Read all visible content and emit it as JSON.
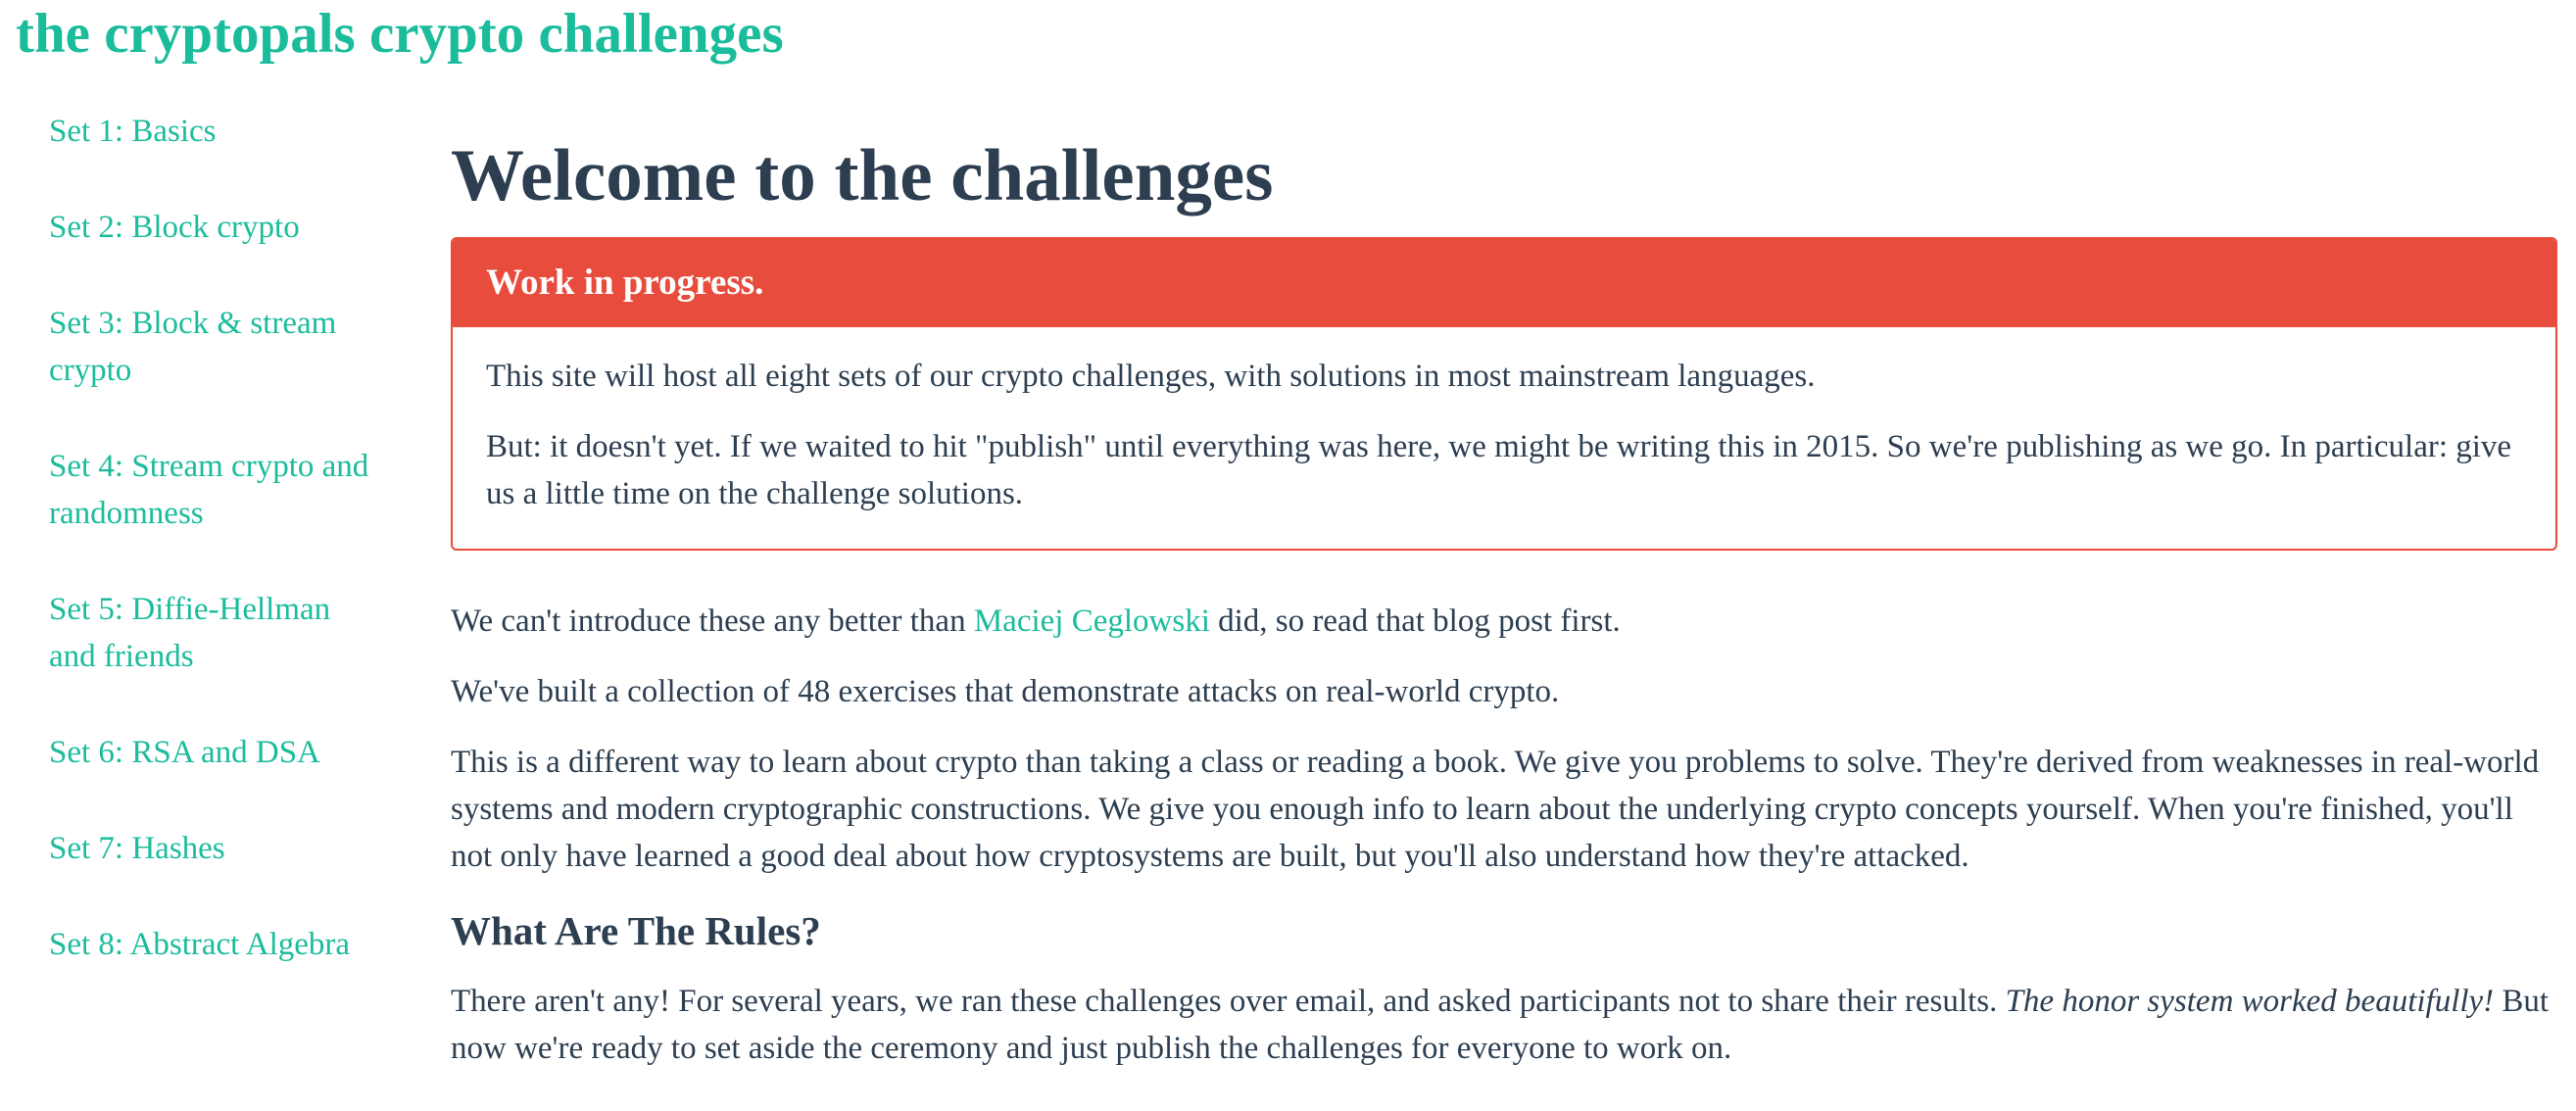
{
  "site": {
    "title": "the cryptopals crypto challenges"
  },
  "sidebar": {
    "items": [
      {
        "label": "Set 1: Basics"
      },
      {
        "label": "Set 2: Block crypto"
      },
      {
        "label": "Set 3: Block & stream crypto"
      },
      {
        "label": "Set 4: Stream crypto and randomness"
      },
      {
        "label": "Set 5: Diffie-Hellman and friends"
      },
      {
        "label": "Set 6: RSA and DSA"
      },
      {
        "label": "Set 7: Hashes"
      },
      {
        "label": "Set 8: Abstract Algebra"
      }
    ]
  },
  "main": {
    "title": "Welcome to the challenges",
    "alert": {
      "heading": "Work in progress.",
      "p1": "This site will host all eight sets of our crypto challenges, with solutions in most mainstream languages.",
      "p2": "But: it doesn't yet. If we waited to hit \"publish\" until everything was here, we might be writing this in 2015. So we're publishing as we go. In particular: give us a little time on the challenge solutions."
    },
    "intro": {
      "before": "We can't introduce these any better than ",
      "link": "Maciej Ceglowski",
      "after": " did, so read that blog post first."
    },
    "p2": "We've built a collection of 48 exercises that demonstrate attacks on real-world crypto.",
    "p3": "This is a different way to learn about crypto than taking a class or reading a book. We give you problems to solve. They're derived from weaknesses in real-world systems and modern cryptographic constructions. We give you enough info to learn about the underlying crypto concepts yourself. When you're finished, you'll not only have learned a good deal about how cryptosystems are built, but you'll also understand how they're attacked.",
    "rules": {
      "heading": "What Are The Rules?",
      "before": "There aren't any! For several years, we ran these challenges over email, and asked participants not to share their results. ",
      "emphasis": "The honor system worked beautifully!",
      "after": " But now we're ready to set aside the ceremony and just publish the challenges for everyone to work on."
    }
  },
  "colors": {
    "accent": "#1abc9c",
    "text": "#2c3e50",
    "alert": "#e74c3c"
  }
}
